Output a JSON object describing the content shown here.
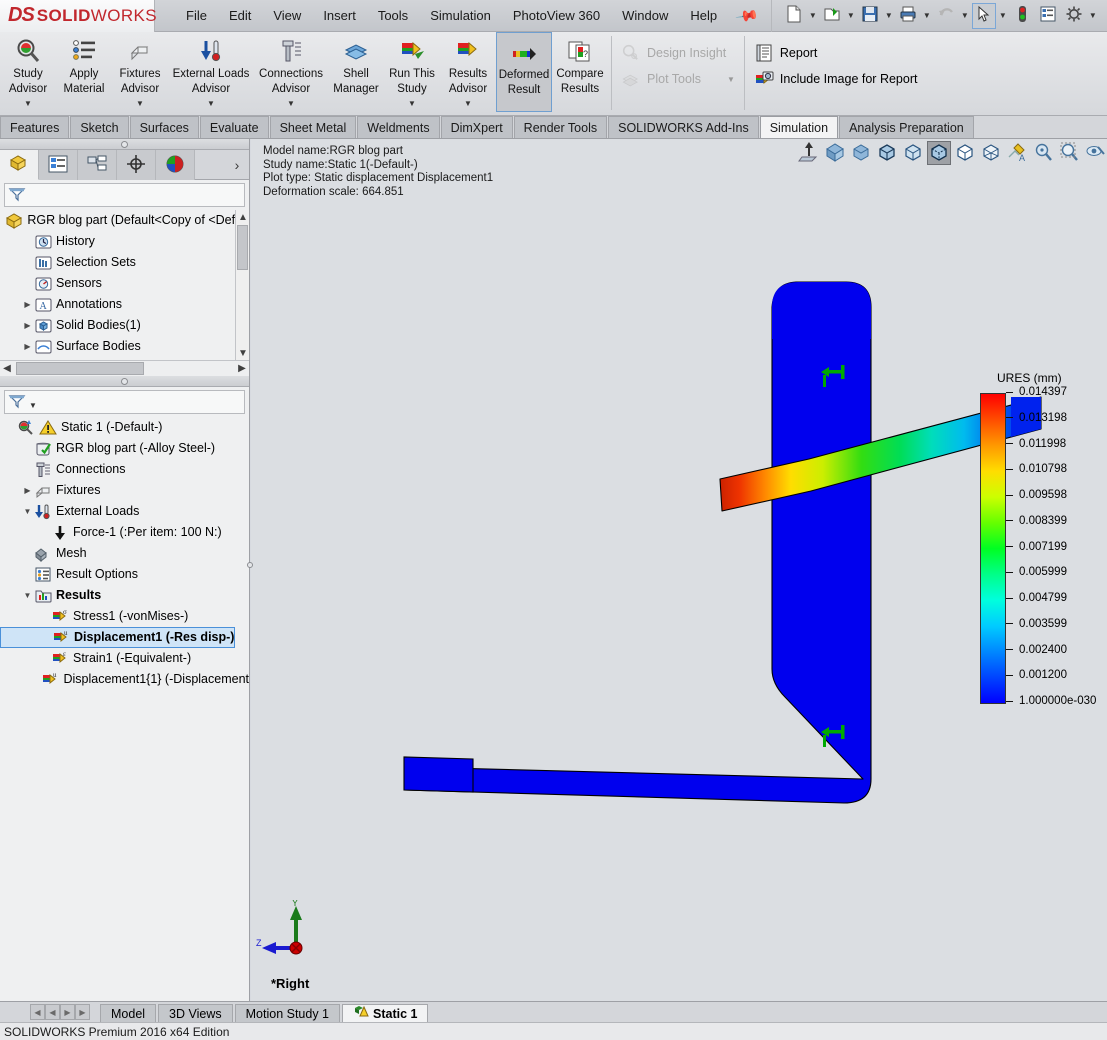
{
  "app": {
    "logo": {
      "ds": "DS",
      "solid": "SOLID",
      "works": "WORKS"
    },
    "status_text": "SOLIDWORKS Premium 2016 x64 Edition"
  },
  "menubar": {
    "items": [
      "File",
      "Edit",
      "View",
      "Insert",
      "Tools",
      "Simulation",
      "PhotoView 360",
      "Window",
      "Help"
    ],
    "pin_icon": "pin-icon",
    "quick_access": [
      {
        "name": "new-document-button",
        "icon": "new-document-icon",
        "caret": true
      },
      {
        "name": "open-document-button",
        "icon": "open-folder-icon",
        "caret": true
      },
      {
        "name": "save-button",
        "icon": "save-disk-icon",
        "caret": true
      },
      {
        "name": "print-button",
        "icon": "printer-icon",
        "caret": true
      },
      {
        "name": "undo-button",
        "icon": "undo-arrow-icon",
        "caret": true
      },
      {
        "name": "select-button",
        "icon": "cursor-arrow-icon",
        "caret": true,
        "selected": true
      },
      {
        "name": "rebuild-button",
        "icon": "traffic-light-icon",
        "caret": false
      },
      {
        "name": "options-display-button",
        "icon": "list-panel-icon",
        "caret": false
      },
      {
        "name": "options-button",
        "icon": "gear-icon",
        "caret": true
      }
    ]
  },
  "ribbon": {
    "buttons": [
      {
        "label": "Study\nAdvisor",
        "icon": "magnifier-color-icon",
        "caret": true,
        "name": "study-advisor-button"
      },
      {
        "label": "Apply\nMaterial",
        "icon": "material-list-icon",
        "caret": false,
        "name": "apply-material-button"
      },
      {
        "label": "Fixtures\nAdvisor",
        "icon": "fixture-icon",
        "caret": true,
        "name": "fixtures-advisor-button"
      },
      {
        "label": "External Loads\nAdvisor",
        "icon": "external-load-icon",
        "caret": true,
        "name": "external-loads-advisor-button"
      },
      {
        "label": "Connections\nAdvisor",
        "icon": "bolt-icon",
        "caret": true,
        "name": "connections-advisor-button"
      },
      {
        "label": "Shell\nManager",
        "icon": "shell-layers-icon",
        "caret": false,
        "name": "shell-manager-button"
      },
      {
        "label": "Run This\nStudy",
        "icon": "run-study-icon",
        "caret": true,
        "name": "run-this-study-button"
      },
      {
        "label": "Results\nAdvisor",
        "icon": "results-advisor-icon",
        "caret": true,
        "name": "results-advisor-button"
      },
      {
        "label": "Deformed\nResult",
        "icon": "deformed-result-icon",
        "caret": false,
        "active": true,
        "name": "deformed-result-button"
      },
      {
        "label": "Compare\nResults",
        "icon": "compare-results-icon",
        "caret": false,
        "name": "compare-results-button"
      }
    ],
    "stack_left": [
      {
        "label": "Design Insight",
        "icon": "design-insight-icon",
        "disabled": true,
        "caret": false,
        "name": "design-insight-button"
      },
      {
        "label": "Plot Tools",
        "icon": "plot-tools-icon",
        "disabled": true,
        "caret": true,
        "name": "plot-tools-button"
      }
    ],
    "stack_right": [
      {
        "label": "Report",
        "icon": "report-icon",
        "disabled": false,
        "caret": false,
        "name": "report-button"
      },
      {
        "label": "Include Image for Report",
        "icon": "include-image-icon",
        "disabled": false,
        "caret": false,
        "name": "include-image-for-report-button"
      }
    ]
  },
  "tabstrip": {
    "tabs": [
      "Features",
      "Sketch",
      "Surfaces",
      "Evaluate",
      "Sheet Metal",
      "Weldments",
      "DimXpert",
      "Render Tools",
      "SOLIDWORKS Add-Ins",
      "Simulation",
      "Analysis Preparation"
    ],
    "active": "Simulation"
  },
  "feature_panel": {
    "tabs": [
      {
        "name": "feature-manager-tab",
        "icon": "feature-tree-icon",
        "active": true
      },
      {
        "name": "property-manager-tab",
        "icon": "property-list-icon",
        "active": false
      },
      {
        "name": "configuration-manager-tab",
        "icon": "configuration-icon",
        "active": false
      },
      {
        "name": "dimxpert-manager-tab",
        "icon": "dimxpert-target-icon",
        "active": false
      },
      {
        "name": "display-manager-tab",
        "icon": "display-sphere-icon",
        "active": false
      }
    ],
    "more_icon": "chevron-right-icon",
    "filter_icon": "filter-funnel-icon",
    "filter_placeholder": "",
    "tree": [
      {
        "label": "RGR blog part  (Default<Copy of <Defau",
        "icon": "part-icon",
        "indent": 0,
        "twisty": ""
      },
      {
        "label": "History",
        "icon": "history-folder-icon",
        "indent": 1,
        "twisty": ""
      },
      {
        "label": "Selection Sets",
        "icon": "selection-sets-icon",
        "indent": 1,
        "twisty": ""
      },
      {
        "label": "Sensors",
        "icon": "sensors-icon",
        "indent": 1,
        "twisty": ""
      },
      {
        "label": "Annotations",
        "icon": "annotations-icon",
        "indent": 1,
        "twisty": "right"
      },
      {
        "label": "Solid Bodies(1)",
        "icon": "solid-bodies-icon",
        "indent": 1,
        "twisty": "right"
      },
      {
        "label": "Surface Bodies",
        "icon": "surface-bodies-icon",
        "indent": 1,
        "twisty": "right"
      }
    ]
  },
  "study_panel": {
    "filter_icon": "filter-funnel-icon",
    "tree": [
      {
        "label": "Static 1 (-Default-)",
        "icon": "static-study-warning-icon",
        "indent": 0,
        "twisty": "",
        "prefix_icon": "study-magnifier-icon"
      },
      {
        "label": "RGR blog part (-Alloy Steel-)",
        "icon": "material-check-icon",
        "indent": 1,
        "twisty": ""
      },
      {
        "label": "Connections",
        "icon": "connections-bolt-icon",
        "indent": 1,
        "twisty": ""
      },
      {
        "label": "Fixtures",
        "icon": "fixtures-icon",
        "indent": 1,
        "twisty": "right"
      },
      {
        "label": "External Loads",
        "icon": "external-loads-icon",
        "indent": 1,
        "twisty": "down"
      },
      {
        "label": "Force-1 (:Per item: 100 N:)",
        "icon": "force-arrow-icon",
        "indent": 2,
        "twisty": ""
      },
      {
        "label": "Mesh",
        "icon": "mesh-warning-icon",
        "indent": 1,
        "twisty": ""
      },
      {
        "label": "Result Options",
        "icon": "result-options-icon",
        "indent": 1,
        "twisty": ""
      },
      {
        "label": "Results",
        "icon": "results-folder-icon",
        "indent": 1,
        "twisty": "down",
        "bold": true
      },
      {
        "label": "Stress1 (-vonMises-)",
        "icon": "stress-plot-icon",
        "indent": 2,
        "twisty": ""
      },
      {
        "label": "Displacement1 (-Res disp-)",
        "icon": "displacement-plot-icon",
        "indent": 2,
        "twisty": "",
        "selected": true,
        "bold": true
      },
      {
        "label": "Strain1 (-Equivalent-)",
        "icon": "strain-plot-icon",
        "indent": 2,
        "twisty": ""
      },
      {
        "label": "Displacement1{1} (-Displacement",
        "icon": "displacement-plot-icon",
        "indent": 2,
        "twisty": ""
      }
    ]
  },
  "graphics": {
    "plot_info": [
      "Model name:RGR blog part",
      "Study name:Static 1(-Default-)",
      "Plot type: Static displacement Displacement1",
      "Deformation scale: 664.851"
    ],
    "view_label": "*Right",
    "triad": {
      "y_label": "Y",
      "z_label": "Z"
    },
    "view_toolbar": [
      {
        "name": "zoom-to-fit-button",
        "icon": "zoom-to-fit-icon"
      },
      {
        "name": "view-orientation-button",
        "icon": "view-cube-icon"
      },
      {
        "name": "display-style-shaded-button",
        "icon": "shaded-box-icon"
      },
      {
        "name": "display-style-shaded-edges-button",
        "icon": "shaded-edges-box-icon"
      },
      {
        "name": "display-style-hidden-removed-button",
        "icon": "hidden-removed-box-icon"
      },
      {
        "name": "display-style-hidden-visible-button",
        "icon": "hidden-visible-box-icon",
        "selected": true
      },
      {
        "name": "display-style-wireframe-button",
        "icon": "wireframe-box-icon"
      },
      {
        "name": "display-style-wireframe2-button",
        "icon": "wireframe-alt-box-icon"
      },
      {
        "name": "apply-scene-button",
        "icon": "apply-scene-icon"
      },
      {
        "name": "view-settings-button",
        "icon": "view-settings-magnifier-icon"
      },
      {
        "name": "zoom-area-button",
        "icon": "zoom-area-icon"
      },
      {
        "name": "hide-show-items-button",
        "icon": "hide-show-icon"
      }
    ],
    "fixture_symbols": 2,
    "fixture_symbol_icon": "fixture-restraint-icon"
  },
  "chart_data": {
    "type": "heatmap",
    "title": "URES (mm)",
    "colormap": "rainbow",
    "tick_labels": [
      "0.014397",
      "0.013198",
      "0.011998",
      "0.010798",
      "0.009598",
      "0.008399",
      "0.007199",
      "0.005999",
      "0.004799",
      "0.003599",
      "0.002400",
      "0.001200",
      "1.000000e-030"
    ],
    "tick_values": [
      0.014397,
      0.013198,
      0.011998,
      0.010798,
      0.009598,
      0.008399,
      0.007199,
      0.005999,
      0.004799,
      0.003599,
      0.0024,
      0.0012,
      1e-30
    ],
    "min_value": 1e-30,
    "max_value": 0.014397,
    "units": "mm",
    "quantity": "URES",
    "legend_position": "right",
    "colors": [
      "#ff0000",
      "#ff4d00",
      "#ff9900",
      "#ffdd00",
      "#ccff00",
      "#66ff00",
      "#00ff22",
      "#00ff88",
      "#00ffdd",
      "#00ccff",
      "#0088ff",
      "#0044ff",
      "#0000ff"
    ]
  },
  "bottom": {
    "nav_buttons": [
      "first-record-icon",
      "previous-record-icon",
      "next-record-icon",
      "last-record-icon"
    ],
    "tabs": [
      {
        "label": "Model",
        "active": false,
        "icon": ""
      },
      {
        "label": "3D Views",
        "active": false,
        "icon": ""
      },
      {
        "label": "Motion Study 1",
        "active": false,
        "icon": ""
      },
      {
        "label": "Static 1",
        "active": true,
        "icon": "study-tab-icon"
      }
    ]
  }
}
